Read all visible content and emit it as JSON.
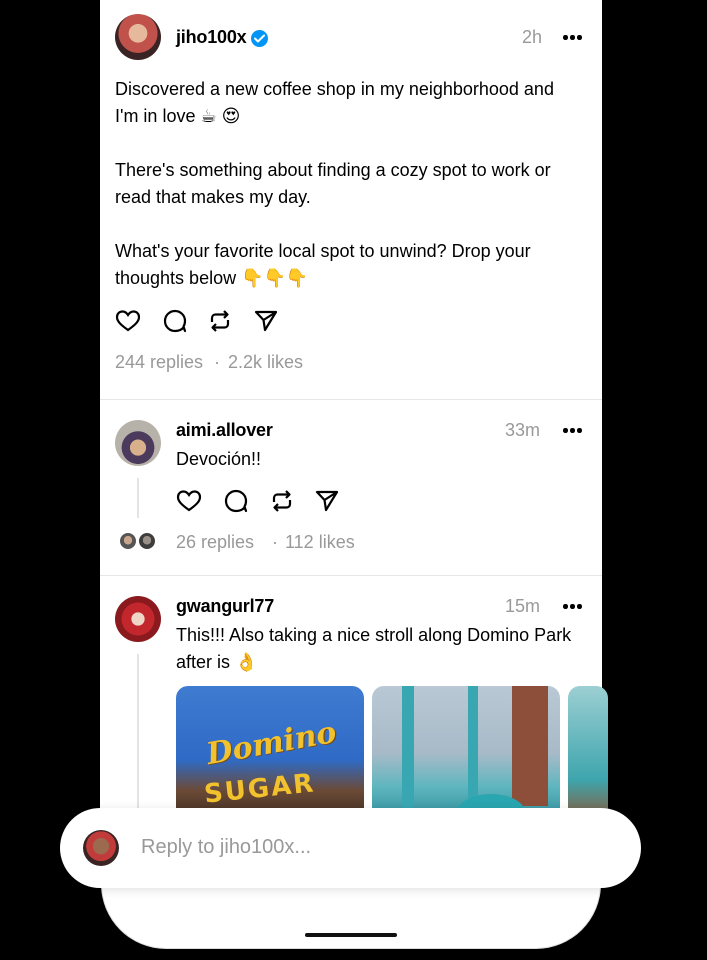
{
  "post": {
    "username": "jiho100x",
    "time": "2h",
    "paragraph1": "Discovered a new coffee shop in my neighborhood and",
    "paragraph1_line2": "I'm in love ☕ 😍",
    "paragraph2_line1": "There's something about finding a cozy spot to work or",
    "paragraph2_line2": "read that makes my day.",
    "paragraph3_line1": "What's your favorite local spot to unwind? Drop your",
    "paragraph3_line2": "thoughts below 👇👇👇",
    "replies": "244 replies",
    "separator": "·",
    "likes": "2.2k likes"
  },
  "reply1": {
    "username": "aimi.allover",
    "time": "33m",
    "text": "Devoción!!",
    "replies": "26 replies",
    "separator": "·",
    "likes": "112 likes"
  },
  "reply2": {
    "username": "gwangurl77",
    "time": "15m",
    "text_line1": "This!!! Also taking a nice stroll along Domino Park",
    "text_line2": "after is 👌",
    "sign_line1": "Domino",
    "sign_line2": "SUGAR"
  },
  "composer": {
    "placeholder": "Reply to jiho100x..."
  },
  "icons": {
    "like": "heart-icon",
    "comment": "comment-icon",
    "repost": "repost-icon",
    "share": "send-icon",
    "more": "more-icon",
    "verified": "verified-badge-icon"
  },
  "colors": {
    "verified": "#0095f6",
    "muted": "#999999"
  }
}
